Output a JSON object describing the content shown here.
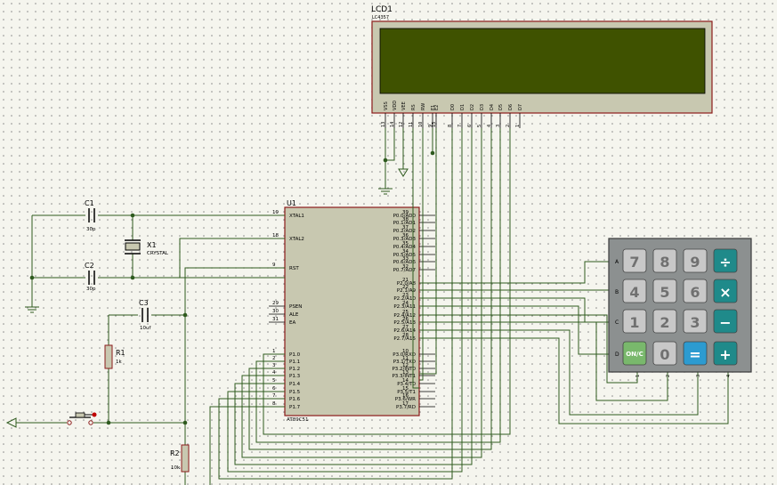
{
  "lcd": {
    "ref": "LCD1",
    "part": "LC4357",
    "pin_names": [
      "VSS",
      "VDD",
      "VEE",
      "RS",
      "RW",
      "E1",
      "E2",
      "D0",
      "D1",
      "D2",
      "D3",
      "D4",
      "D5",
      "D6",
      "D7"
    ],
    "pin_numbers": [
      "13",
      "14",
      "12",
      "11",
      "10",
      "9",
      "15",
      "8",
      "7",
      "6",
      "5",
      "4",
      "3",
      "2",
      "1"
    ],
    "screen_color": "#3f5200"
  },
  "mcu": {
    "ref": "U1",
    "part": "AT89C51",
    "left_pins": [
      {
        "num": "19",
        "name": "XTAL1"
      },
      {
        "num": "18",
        "name": "XTAL2"
      },
      {
        "num": "9",
        "name": "RST"
      },
      {
        "num": "29",
        "name": "PSEN"
      },
      {
        "num": "30",
        "name": "ALE"
      },
      {
        "num": "31",
        "name": "EA"
      },
      {
        "num": "1",
        "name": "P1.0"
      },
      {
        "num": "2",
        "name": "P1.1"
      },
      {
        "num": "3",
        "name": "P1.2"
      },
      {
        "num": "4",
        "name": "P1.3"
      },
      {
        "num": "5",
        "name": "P1.4"
      },
      {
        "num": "6",
        "name": "P1.5"
      },
      {
        "num": "7",
        "name": "P1.6"
      },
      {
        "num": "8",
        "name": "P1.7"
      }
    ],
    "right_pins": [
      {
        "num": "39",
        "name": "P0.0/AD0"
      },
      {
        "num": "38",
        "name": "P0.1/AD1"
      },
      {
        "num": "37",
        "name": "P0.2/AD2"
      },
      {
        "num": "36",
        "name": "P0.3/AD3"
      },
      {
        "num": "35",
        "name": "P0.4/AD4"
      },
      {
        "num": "34",
        "name": "P0.5/AD5"
      },
      {
        "num": "33",
        "name": "P0.6/AD6"
      },
      {
        "num": "32",
        "name": "P0.7/AD7"
      },
      {
        "num": "21",
        "name": "P2.0/A8"
      },
      {
        "num": "22",
        "name": "P2.1/A9"
      },
      {
        "num": "23",
        "name": "P2.2/A10"
      },
      {
        "num": "24",
        "name": "P2.3/A11"
      },
      {
        "num": "25",
        "name": "P2.4/A12"
      },
      {
        "num": "26",
        "name": "P2.5/A13"
      },
      {
        "num": "27",
        "name": "P2.6/A14"
      },
      {
        "num": "28",
        "name": "P2.7/A15"
      },
      {
        "num": "10",
        "name": "P3.0/RXD"
      },
      {
        "num": "11",
        "name": "P3.1/TXD"
      },
      {
        "num": "12",
        "name": "P3.2/INT0"
      },
      {
        "num": "13",
        "name": "P3.3/INT1"
      },
      {
        "num": "14",
        "name": "P3.4/T0"
      },
      {
        "num": "15",
        "name": "P3.5/T1"
      },
      {
        "num": "16",
        "name": "P3.6/WR"
      },
      {
        "num": "17",
        "name": "P3.7/RD"
      }
    ]
  },
  "components": {
    "c1": {
      "ref": "C1",
      "value": "30p"
    },
    "c2": {
      "ref": "C2",
      "value": "30p"
    },
    "c3": {
      "ref": "C3",
      "value": "10uf"
    },
    "x1": {
      "ref": "X1",
      "value": "CRYSTAL"
    },
    "r1": {
      "ref": "R1",
      "value": "1k"
    },
    "r2": {
      "ref": "R2",
      "value": "10k"
    }
  },
  "keypad": {
    "row_labels": [
      "A",
      "B",
      "C",
      "D"
    ],
    "col_labels": [
      "1",
      "2",
      "3",
      "4"
    ],
    "keys": [
      {
        "label": "7",
        "kind": "num"
      },
      {
        "label": "8",
        "kind": "num"
      },
      {
        "label": "9",
        "kind": "num"
      },
      {
        "label": "÷",
        "kind": "op"
      },
      {
        "label": "4",
        "kind": "num"
      },
      {
        "label": "5",
        "kind": "num"
      },
      {
        "label": "6",
        "kind": "num"
      },
      {
        "label": "×",
        "kind": "op"
      },
      {
        "label": "1",
        "kind": "num"
      },
      {
        "label": "2",
        "kind": "num"
      },
      {
        "label": "3",
        "kind": "num"
      },
      {
        "label": "−",
        "kind": "op"
      },
      {
        "label": "ON/C",
        "kind": "on"
      },
      {
        "label": "0",
        "kind": "num"
      },
      {
        "label": "=",
        "kind": "eq"
      },
      {
        "label": "+",
        "kind": "op"
      }
    ],
    "colors": {
      "num": "#c8c8c8",
      "op": "#1f8a8a",
      "on": "#79b86c",
      "eq": "#2c9bd0"
    }
  },
  "colors": {
    "wire": "#2e5a1e",
    "body": "#c8c8b0",
    "outline": "#8b1a1a",
    "background": "#f5f5ee"
  }
}
